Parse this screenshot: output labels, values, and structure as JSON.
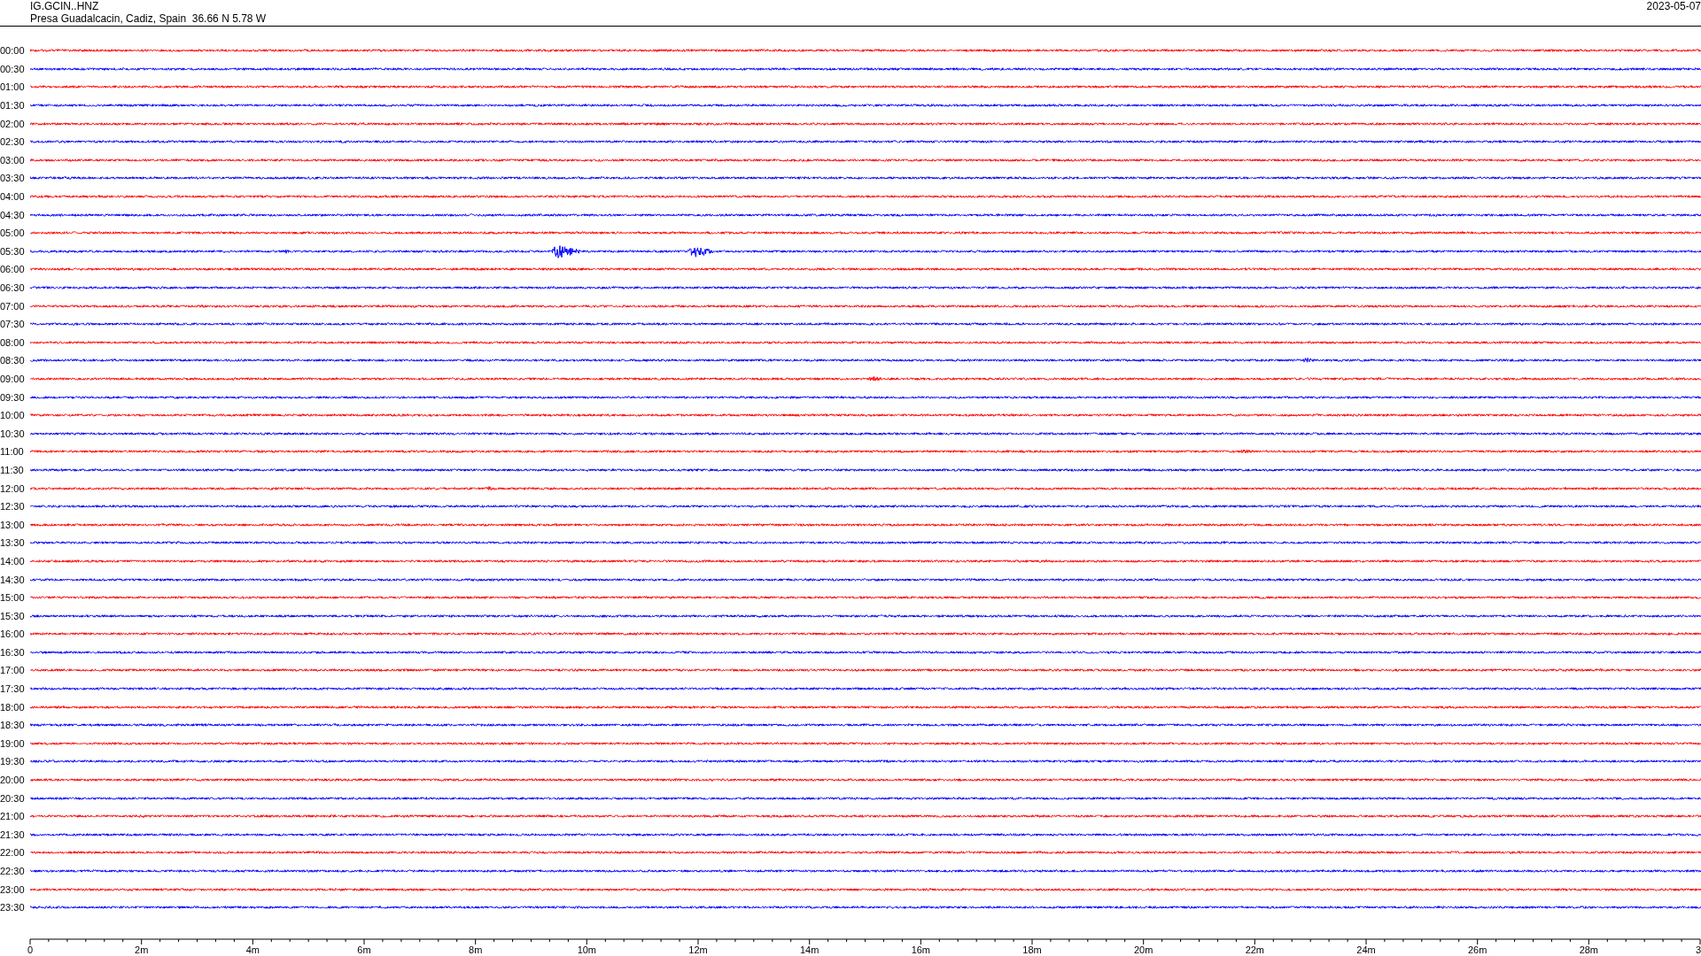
{
  "header": {
    "station": "IG.GCIN..HNZ",
    "location": "Presa Guadalcacin, Cadiz, Spain  36.66 N 5.78 W",
    "date": "2023-05-07"
  },
  "traces": [
    {
      "label": "00:00",
      "color": "#ff0000"
    },
    {
      "label": "00:30",
      "color": "#0000ff"
    },
    {
      "label": "01:00",
      "color": "#ff0000"
    },
    {
      "label": "01:30",
      "color": "#0000ff"
    },
    {
      "label": "02:00",
      "color": "#ff0000"
    },
    {
      "label": "02:30",
      "color": "#0000ff"
    },
    {
      "label": "03:00",
      "color": "#ff0000"
    },
    {
      "label": "03:30",
      "color": "#0000ff"
    },
    {
      "label": "04:00",
      "color": "#ff0000"
    },
    {
      "label": "04:30",
      "color": "#0000ff"
    },
    {
      "label": "05:00",
      "color": "#ff0000"
    },
    {
      "label": "05:30",
      "color": "#0000ff"
    },
    {
      "label": "06:00",
      "color": "#ff0000"
    },
    {
      "label": "06:30",
      "color": "#0000ff"
    },
    {
      "label": "07:00",
      "color": "#ff0000"
    },
    {
      "label": "07:30",
      "color": "#0000ff"
    },
    {
      "label": "08:00",
      "color": "#ff0000"
    },
    {
      "label": "08:30",
      "color": "#0000ff"
    },
    {
      "label": "09:00",
      "color": "#ff0000"
    },
    {
      "label": "09:30",
      "color": "#0000ff"
    },
    {
      "label": "10:00",
      "color": "#ff0000"
    },
    {
      "label": "10:30",
      "color": "#0000ff"
    },
    {
      "label": "11:00",
      "color": "#ff0000"
    },
    {
      "label": "11:30",
      "color": "#0000ff"
    },
    {
      "label": "12:00",
      "color": "#ff0000"
    },
    {
      "label": "12:30",
      "color": "#0000ff"
    },
    {
      "label": "13:00",
      "color": "#ff0000"
    },
    {
      "label": "13:30",
      "color": "#0000ff"
    },
    {
      "label": "14:00",
      "color": "#ff0000"
    },
    {
      "label": "14:30",
      "color": "#0000ff"
    },
    {
      "label": "15:00",
      "color": "#ff0000"
    },
    {
      "label": "15:30",
      "color": "#0000ff"
    },
    {
      "label": "16:00",
      "color": "#ff0000"
    },
    {
      "label": "16:30",
      "color": "#0000ff"
    },
    {
      "label": "17:00",
      "color": "#ff0000"
    },
    {
      "label": "17:30",
      "color": "#0000ff"
    },
    {
      "label": "18:00",
      "color": "#ff0000"
    },
    {
      "label": "18:30",
      "color": "#0000ff"
    },
    {
      "label": "19:00",
      "color": "#ff0000"
    },
    {
      "label": "19:30",
      "color": "#0000ff"
    },
    {
      "label": "20:00",
      "color": "#ff0000"
    },
    {
      "label": "20:30",
      "color": "#0000ff"
    },
    {
      "label": "21:00",
      "color": "#ff0000"
    },
    {
      "label": "21:30",
      "color": "#0000ff"
    },
    {
      "label": "22:00",
      "color": "#ff0000"
    },
    {
      "label": "22:30",
      "color": "#0000ff"
    },
    {
      "label": "23:00",
      "color": "#ff0000"
    },
    {
      "label": "23:30",
      "color": "#0000ff"
    }
  ],
  "time_axis": {
    "labels": [
      "0",
      "2m",
      "4m",
      "6m",
      "8m",
      "10m",
      "12m",
      "14m",
      "16m",
      "18m",
      "20m",
      "22m",
      "24m",
      "26m",
      "28m",
      "3"
    ]
  }
}
